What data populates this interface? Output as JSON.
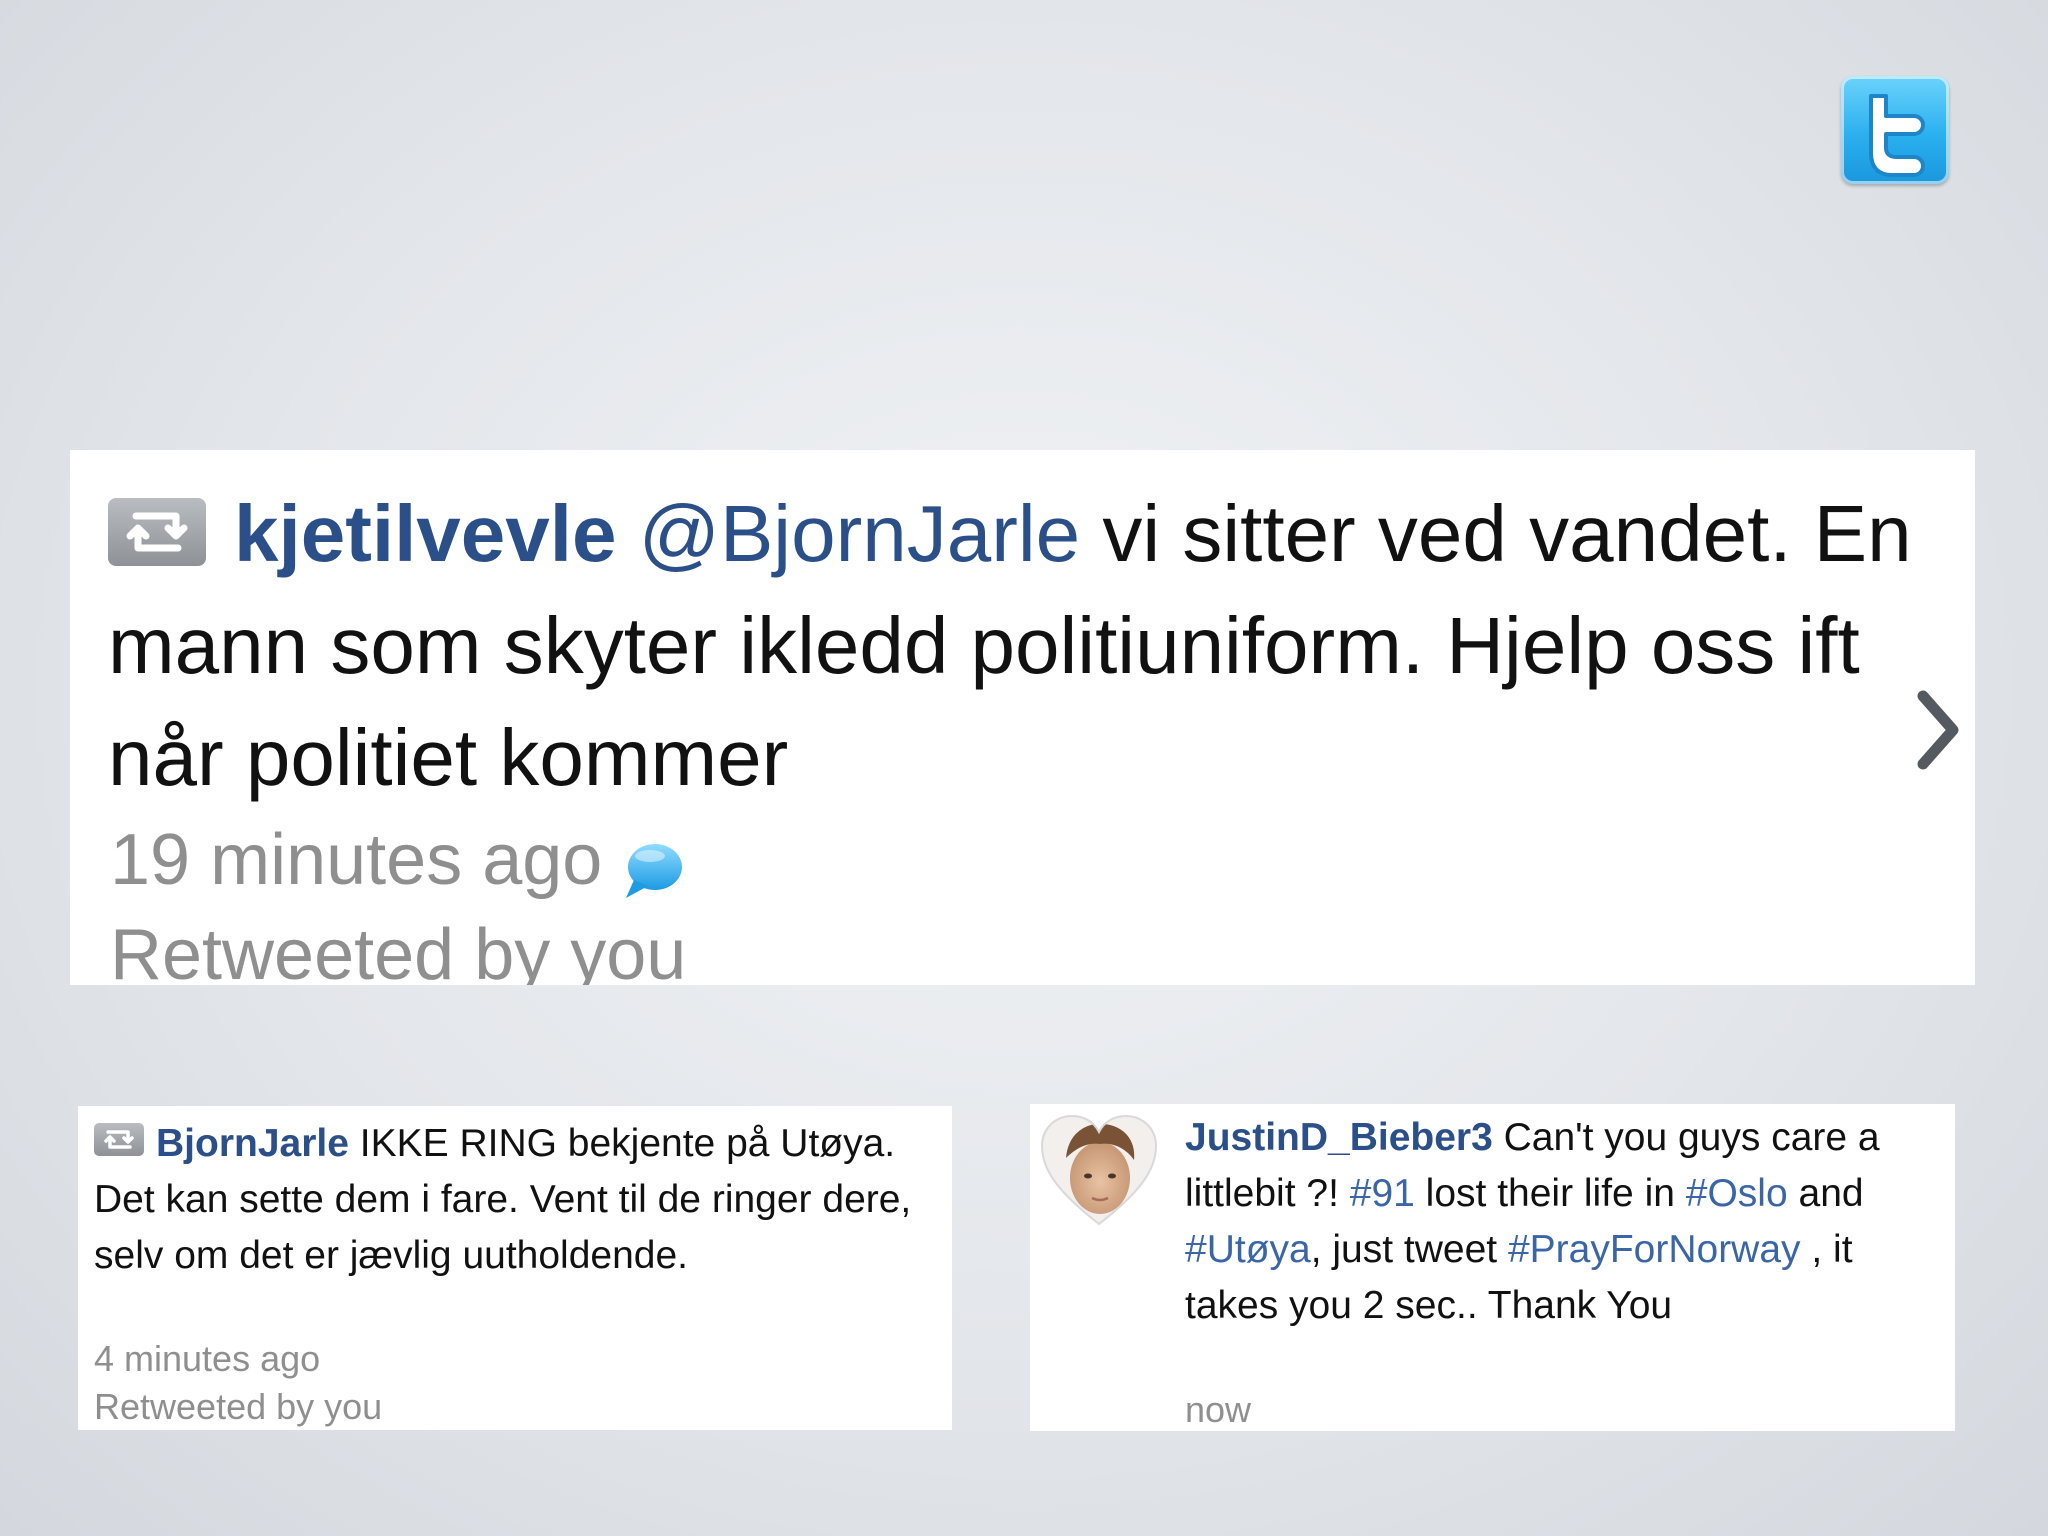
{
  "logo": {
    "icon": "twitter-bird-t-logo",
    "color": "#2ab0ef"
  },
  "colors": {
    "username": "#2b4f88",
    "hashtag": "#3a66a8",
    "meta": "#8f8f8f"
  },
  "main_tweet": {
    "retweet_icon": "retweet-icon",
    "username": "kjetilvevle",
    "mention": "@BjornJarle",
    "text": " vi sitter ved vandet. En mann som skyter ikledd politiuniform. Hjelp oss ift når politiet kommer",
    "time": "19 minutes ago",
    "reply_icon": "speech-bubble-icon",
    "retweeted_by": "Retweeted by you",
    "chevron_icon": "chevron-right-icon"
  },
  "left_tweet": {
    "retweet_icon": "retweet-icon",
    "username": "BjornJarle",
    "text": " IKKE RING bekjente på Utøya. Det kan sette dem i fare. Vent til de ringer dere, selv om det er jævlig uutholdende.",
    "time": "4 minutes ago",
    "retweeted_by": "Retweeted by you"
  },
  "right_tweet": {
    "avatar_icon": "heart-avatar",
    "username": "JustinD_Bieber3",
    "text_1": " Can't you guys care a littlebit ?! ",
    "hashtag_1": "#91",
    "text_2": " lost their life in ",
    "hashtag_2": "#Oslo",
    "text_3": " and ",
    "hashtag_3": "#Utøya",
    "text_4": ", just tweet ",
    "hashtag_4": "#PrayForNorway",
    "text_5": " , it takes you 2 sec.. Thank You",
    "time": "now"
  }
}
